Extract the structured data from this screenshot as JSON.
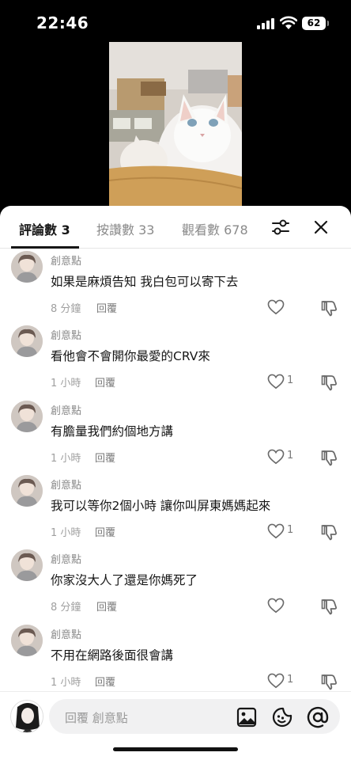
{
  "status": {
    "time": "22:46",
    "battery": "62"
  },
  "tabs": {
    "comments": "評論數 3",
    "likes": "按讚數 33",
    "views": "觀看數 678"
  },
  "comments": [
    {
      "user": "創意點",
      "text": "如果是麻煩告知 我白包可以寄下去",
      "time": "8 分鐘",
      "reply": "回覆",
      "likes": ""
    },
    {
      "user": "創意點",
      "text": "看他會不會開你最愛的CRV來",
      "time": "1 小時",
      "reply": "回覆",
      "likes": "1"
    },
    {
      "user": "創意點",
      "text": "有膽量我們約個地方講",
      "time": "1 小時",
      "reply": "回覆",
      "likes": "1"
    },
    {
      "user": "創意點",
      "text": "我可以等你2個小時 讓你叫屏東媽媽起來",
      "time": "1 小時",
      "reply": "回覆",
      "likes": "1"
    },
    {
      "user": "創意點",
      "text": "你家沒大人了還是你媽死了",
      "time": "8 分鐘",
      "reply": "回覆",
      "likes": ""
    },
    {
      "user": "創意點",
      "text": "不用在網路後面很會講",
      "time": "1 小時",
      "reply": "回覆",
      "likes": "1"
    }
  ],
  "input": {
    "placeholder": "回覆 創意點"
  },
  "icons": {
    "filter": "sliders-icon",
    "close": "close-icon",
    "like": "heart-icon",
    "dislike": "thumbs-down-icon",
    "image": "image-icon",
    "emoji": "sticker-icon",
    "mention": "at-icon"
  }
}
